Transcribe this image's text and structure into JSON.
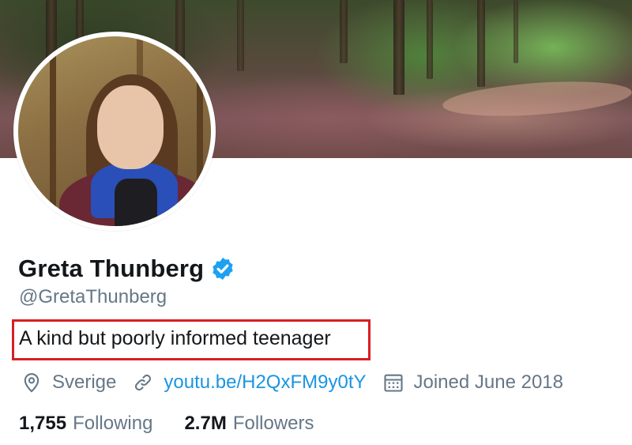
{
  "profile": {
    "display_name": "Greta Thunberg",
    "handle": "@GretaThunberg",
    "bio": "A kind but poorly informed teenager",
    "verified": true,
    "location": "Sverige",
    "website": "youtu.be/H2QxFM9y0tY",
    "joined": "Joined June 2018"
  },
  "stats": {
    "following_count": "1,755",
    "following_label": "Following",
    "followers_count": "2.7M",
    "followers_label": "Followers"
  },
  "icons": {
    "location": "location-pin-icon",
    "link": "link-icon",
    "calendar": "calendar-icon",
    "verified": "verified-badge-icon"
  },
  "colors": {
    "verified_blue": "#1da1f2",
    "link_blue": "#1b95e0",
    "secondary_text": "#657786",
    "primary_text": "#14171a",
    "highlight_box": "#d81e25"
  }
}
